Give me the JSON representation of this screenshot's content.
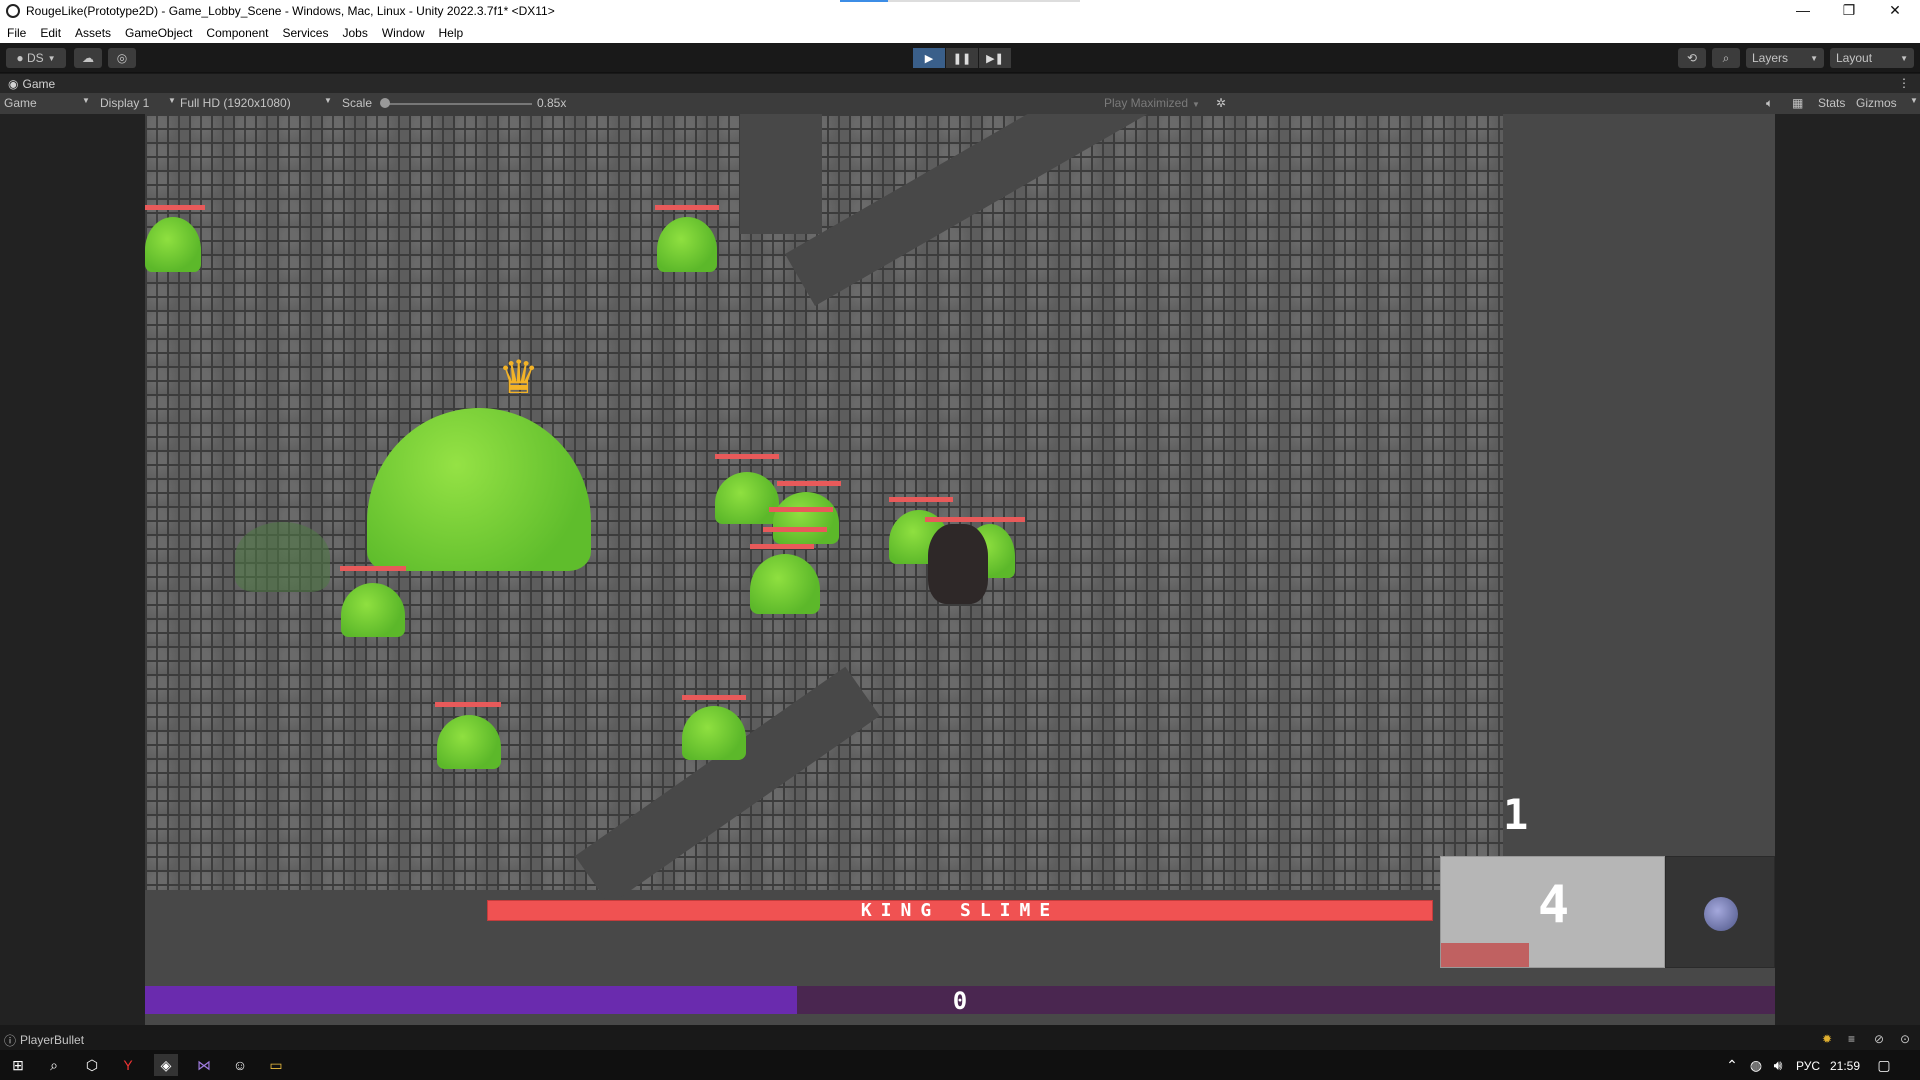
{
  "window": {
    "title": "RougeLike(Prototype2D) - Game_Lobby_Scene - Windows, Mac, Linux - Unity 2022.3.7f1* <DX11>",
    "minimize": "—",
    "maximize": "❐",
    "close": "✕"
  },
  "menu": [
    "File",
    "Edit",
    "Assets",
    "GameObject",
    "Component",
    "Services",
    "Jobs",
    "Window",
    "Help"
  ],
  "toolbar": {
    "account": "DS",
    "layers": "Layers",
    "layout": "Layout"
  },
  "game_tab": {
    "tab_label": "Game",
    "mode": "Game",
    "display": "Display 1",
    "resolution": "Full HD (1920x1080)",
    "scale_label": "Scale",
    "scale_value": "0.85x",
    "play_mode": "Play Maximized",
    "stats": "Stats",
    "gizmos": "Gizmos"
  },
  "game": {
    "boss_name": "KING SLIME",
    "ammo": "4",
    "level": "1",
    "xp": "0",
    "xp_fraction": 0.4
  },
  "status": {
    "message": "PlayerBullet"
  },
  "taskbar": {
    "lang": "РУС",
    "time": "21:59"
  }
}
